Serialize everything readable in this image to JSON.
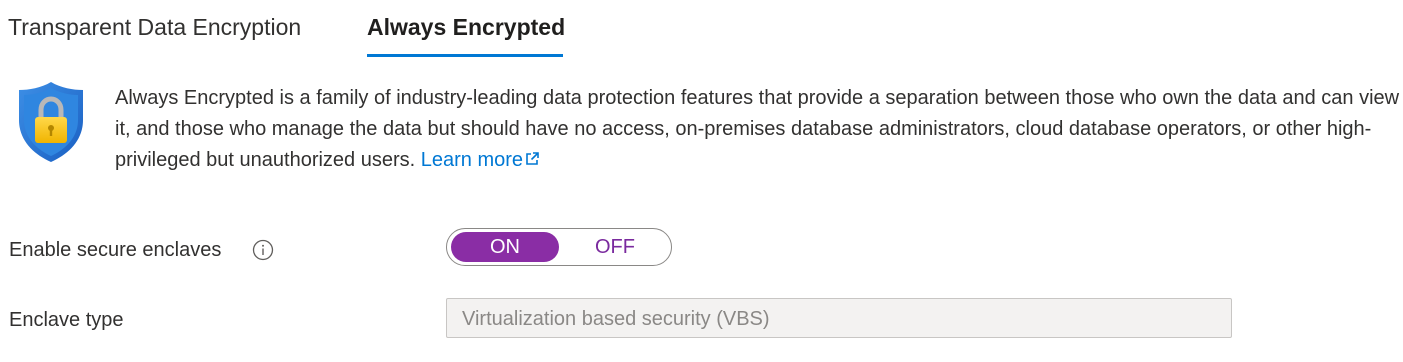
{
  "tabs": [
    {
      "label": "Transparent Data Encryption",
      "selected": false
    },
    {
      "label": "Always Encrypted",
      "selected": true
    }
  ],
  "info": {
    "icon": "shield-lock-icon",
    "description": "Always Encrypted is a family of industry-leading data protection features that provide a separation between those who own the data and can view it, and those who manage the data but should have no access, on-premises database administrators, cloud database operators, or other high-privileged but unauthorized users.",
    "learn_more": "Learn more",
    "learn_more_icon": "external-link-icon"
  },
  "form": {
    "enable_enclaves": {
      "label": "Enable secure enclaves",
      "info_icon": "info-icon",
      "on_label": "ON",
      "off_label": "OFF",
      "value": "ON"
    },
    "enclave_type": {
      "label": "Enclave type",
      "value": "Virtualization based security (VBS)",
      "disabled": true
    }
  },
  "colors": {
    "accent": "#0078d4",
    "toggle_on": "#8a2da5",
    "shield_blue": "#1e73d6",
    "lock_yellow": "#f2c500"
  }
}
